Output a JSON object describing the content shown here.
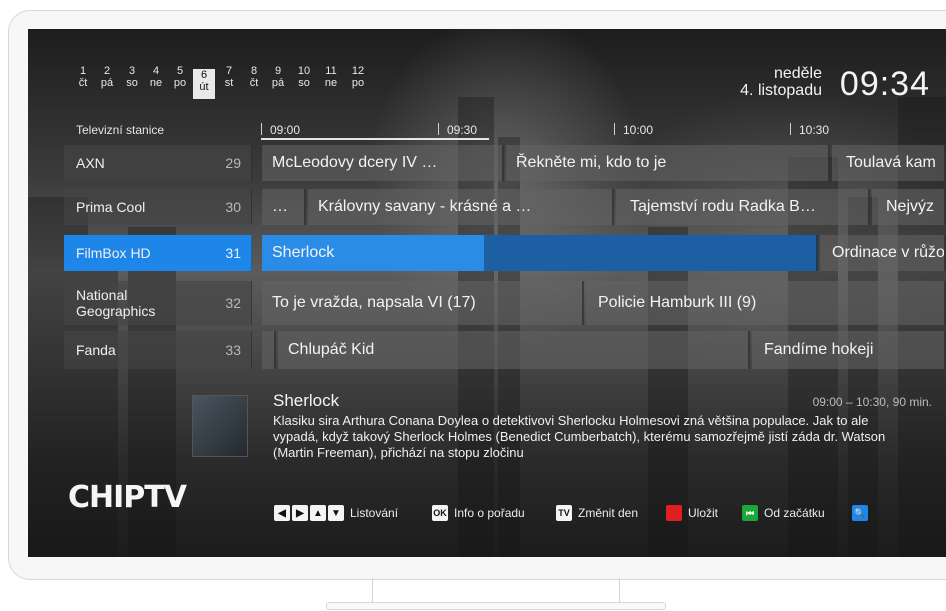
{
  "days": [
    {
      "num": "1",
      "dow": "čt",
      "selected": false
    },
    {
      "num": "2",
      "dow": "pá",
      "selected": false
    },
    {
      "num": "3",
      "dow": "so",
      "selected": false
    },
    {
      "num": "4",
      "dow": "ne",
      "selected": false
    },
    {
      "num": "5",
      "dow": "po",
      "selected": false
    },
    {
      "num": "6",
      "dow": "út",
      "selected": true
    },
    {
      "num": "7",
      "dow": "st",
      "selected": false
    },
    {
      "num": "8",
      "dow": "čt",
      "selected": false
    },
    {
      "num": "9",
      "dow": "pá",
      "selected": false
    },
    {
      "num": "10",
      "dow": "so",
      "selected": false
    },
    {
      "num": "11",
      "dow": "ne",
      "selected": false
    },
    {
      "num": "12",
      "dow": "po",
      "selected": false
    }
  ],
  "clock": {
    "weekday": "neděle",
    "date": "4. listopadu",
    "time": "09:34"
  },
  "grid": {
    "stations_header": "Televizní stanice",
    "times": [
      "09:00",
      "09:30",
      "10:00",
      "10:30"
    ],
    "channels": [
      {
        "name": "AXN",
        "number": "29",
        "selected": false,
        "programs": [
          "McLeodovy dcery IV …",
          "Řekněte mi, kdo to je",
          "Toulavá kam"
        ]
      },
      {
        "name": "Prima Cool",
        "number": "30",
        "selected": false,
        "programs": [
          "…",
          "Královny savany - krásné a …",
          "Tajemství rodu Radka B…",
          "Nejvýz"
        ]
      },
      {
        "name": "FilmBox HD",
        "number": "31",
        "selected": true,
        "programs": [
          "Sherlock",
          "Ordinace v růžov"
        ]
      },
      {
        "name": "National Geographics",
        "number": "32",
        "selected": false,
        "programs": [
          "To je vražda, napsala VI (17)",
          "Policie Hamburk III (9)"
        ]
      },
      {
        "name": "Fanda",
        "number": "33",
        "selected": false,
        "programs": [
          "Chlupáč Kid",
          "Fandíme hokeji"
        ]
      }
    ]
  },
  "info": {
    "title": "Sherlock",
    "time": "09:00 – 10:30, 90 min.",
    "description": "Klasiku sira Arthura Conana Doylea o detektivovi Sherlocku Holmesovi zná většina populace. Jak to ale vypadá, když takový Sherlock Holmes (Benedict Cumberbatch), kterému samozřejmě jistí záda dr. Watson (Martin Freeman), přichází na stopu zločinu"
  },
  "logo": {
    "text": "CHIPTV"
  },
  "legend": {
    "browse": "Listování",
    "ok_key": "OK",
    "info": "Info o pořadu",
    "tv_key": "TV",
    "change_day": "Změnit den",
    "save": "Uložit",
    "from_start": "Od začátku"
  },
  "colors": {
    "accent": "#1e86e8",
    "red_key": "#e02020",
    "green_key": "#1aa83a",
    "blue_key": "#1e86e8"
  }
}
